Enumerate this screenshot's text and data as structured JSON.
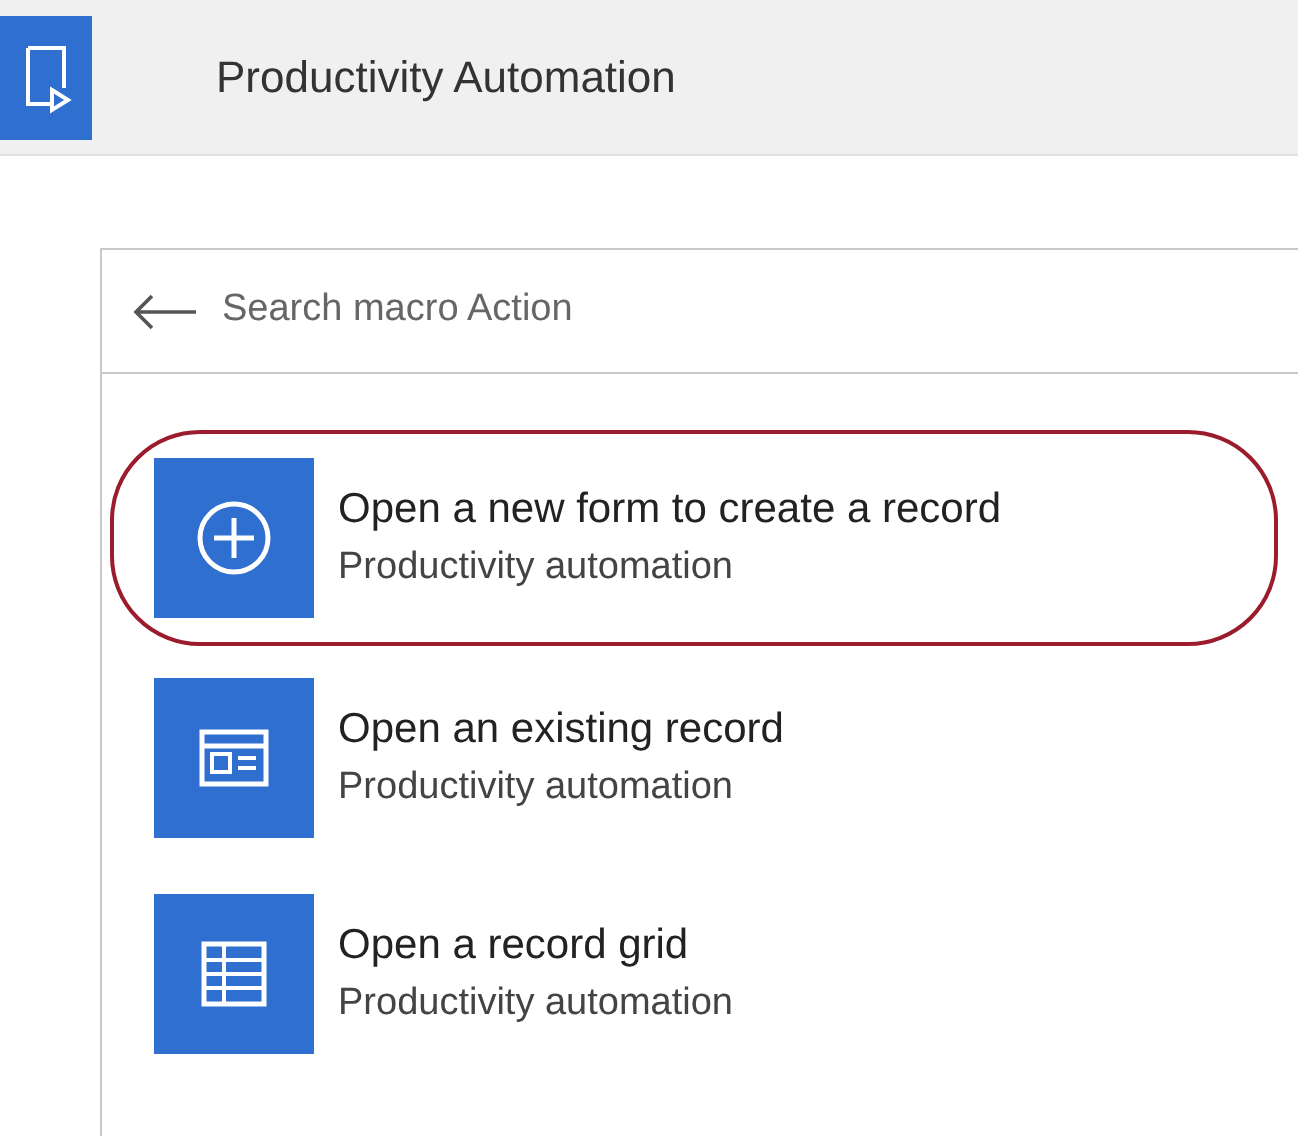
{
  "header": {
    "title": "Productivity Automation"
  },
  "search": {
    "placeholder": "Search macro Action"
  },
  "actions": [
    {
      "kind": "add",
      "title": "Open a new form to create a record",
      "subtitle": "Productivity automation",
      "highlighted": true
    },
    {
      "kind": "form",
      "title": "Open an existing record",
      "subtitle": "Productivity automation",
      "highlighted": false
    },
    {
      "kind": "grid",
      "title": "Open a record grid",
      "subtitle": "Productivity automation",
      "highlighted": false
    }
  ]
}
